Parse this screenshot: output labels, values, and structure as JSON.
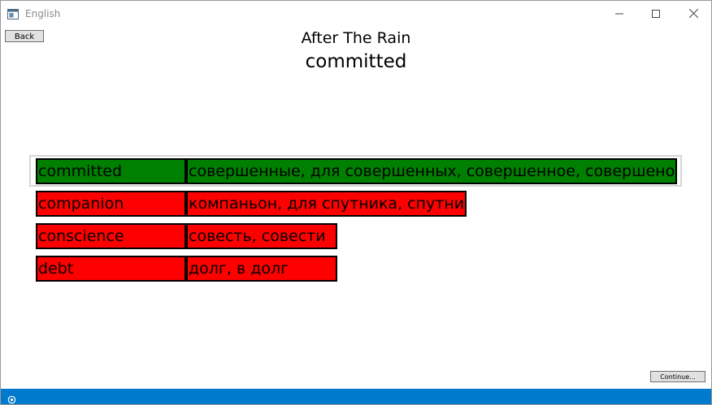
{
  "window": {
    "title": "English",
    "icons": [
      "app-window-icon",
      "minimize-icon",
      "maximize-icon",
      "close-icon"
    ]
  },
  "toolbar": {
    "back_label": "Back",
    "continue_label": "Continue..."
  },
  "header": {
    "song_title": "After The Rain",
    "current_word": "committed"
  },
  "words": [
    {
      "word": "committed",
      "translation": "совершенные, для совершенных, совершенное, совершено",
      "status": "correct",
      "selected": true
    },
    {
      "word": "companion",
      "translation": "компаньон, для спутника, спутник",
      "status": "incorrect",
      "selected": false
    },
    {
      "word": "conscience",
      "translation": "совесть, совести",
      "status": "incorrect",
      "selected": false
    },
    {
      "word": "debt",
      "translation": "долг, в долг",
      "status": "incorrect",
      "selected": false
    }
  ],
  "colors": {
    "correct": "#008000",
    "incorrect": "#ff0000",
    "status_bar": "#007acc"
  },
  "status_bar": {
    "icon": "settings-icon"
  }
}
